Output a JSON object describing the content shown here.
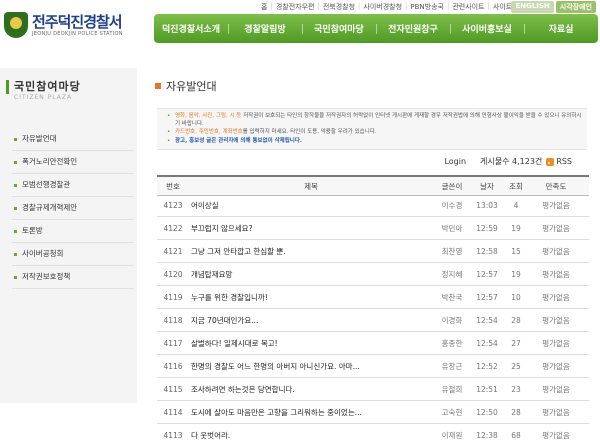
{
  "header": {
    "logo_title": "전주덕진경찰서",
    "logo_sub": "JEONJU DEOKJIN POLICE STATION",
    "top_links": [
      "홈",
      "경찰전자우편",
      "전북경찰청",
      "사이버경찰청",
      "PBN방송국",
      "관련사이트",
      "사이트맵"
    ],
    "lang_english": "ENGLISH",
    "lang_sign": "시각장애인"
  },
  "main_nav": [
    "덕진경찰서소개",
    "경찰알림방",
    "국민참여마당",
    "전자민원창구",
    "사이버홍보실",
    "자료실"
  ],
  "sidebar": {
    "title": "국민참여마당",
    "subtitle": "CITIZEN PLAZA",
    "items": [
      "자유발언대",
      "폭거노리안전확인",
      "모범선행경찰관",
      "경찰규제개혁제안",
      "토론방",
      "사이버공청회",
      "저작권보호정책"
    ]
  },
  "page": {
    "title": "자유발언대",
    "notice": {
      "l1_pre": "영화, 음악, 사진, 그림, 시 등",
      "l1_post": " 저작권이 보호되는 타인의 창작물을 저작권자의 허락없이 인터넷 게시판에 게재할 경우 저작권법에 의해 민형사상 불이익을 받을 수 있으니 유의하시기 바랍니다.",
      "l2_pre": "카드번호, 주민번호, 계좌번호",
      "l2_post": "를 입력하지 마세요. 타인이 도용, 악용할 우려가 있습니다.",
      "l3": "광고, 홍보성 글은 관리자에 의해 통보없이 삭제됩니다."
    },
    "login": "Login",
    "total": "게시물수 4,123건",
    "rss": "RSS"
  },
  "table": {
    "headers": {
      "no": "번호",
      "subject": "제목",
      "writer": "글쓴이",
      "date": "날자",
      "views": "조회",
      "rating": "만족도"
    },
    "rows": [
      {
        "no": "4123",
        "subject": "어이상실",
        "writer": "이수경",
        "date": "13:03",
        "views": "4",
        "rating": "평가없음"
      },
      {
        "no": "4122",
        "subject": "부끄럽지 않으세요?",
        "writer": "박민아",
        "date": "12:59",
        "views": "19",
        "rating": "평가없음"
      },
      {
        "no": "4121",
        "subject": "그냥 그저 안타깝고 한심할 뿐.",
        "writer": "최찬영",
        "date": "12:58",
        "views": "15",
        "rating": "평가없음"
      },
      {
        "no": "4120",
        "subject": "개념탑재요망",
        "writer": "정지혜",
        "date": "12:57",
        "views": "19",
        "rating": "평가없음"
      },
      {
        "no": "4119",
        "subject": "누구를 위한 경찰입니까!",
        "writer": "박찬국",
        "date": "12:57",
        "views": "10",
        "rating": "평가없음"
      },
      {
        "no": "4118",
        "subject": "지금 70년대인가요...",
        "writer": "이경화",
        "date": "12:54",
        "views": "28",
        "rating": "평가없음"
      },
      {
        "no": "4117",
        "subject": "살벌하다! 일제시대로 복고!",
        "writer": "홍종한",
        "date": "12:54",
        "views": "27",
        "rating": "평가없음"
      },
      {
        "no": "4116",
        "subject": "한명의 경찰도 어느 한명의 아버지 아니신가요. 아마...",
        "writer": "유창근",
        "date": "12:52",
        "views": "25",
        "rating": "평가없음"
      },
      {
        "no": "4115",
        "subject": "조사하려면 하는것은 당연합니다.",
        "writer": "유철희",
        "date": "12:51",
        "views": "23",
        "rating": "평가없음"
      },
      {
        "no": "4114",
        "subject": "도시에 살아도 마음만은 고향을 그리워하는 중이었는...",
        "writer": "고숙현",
        "date": "12:50",
        "views": "28",
        "rating": "평가없음"
      },
      {
        "no": "4113",
        "subject": "다 웃벗어라.",
        "writer": "이재원",
        "date": "12:38",
        "views": "68",
        "rating": "평가없음"
      }
    ]
  }
}
